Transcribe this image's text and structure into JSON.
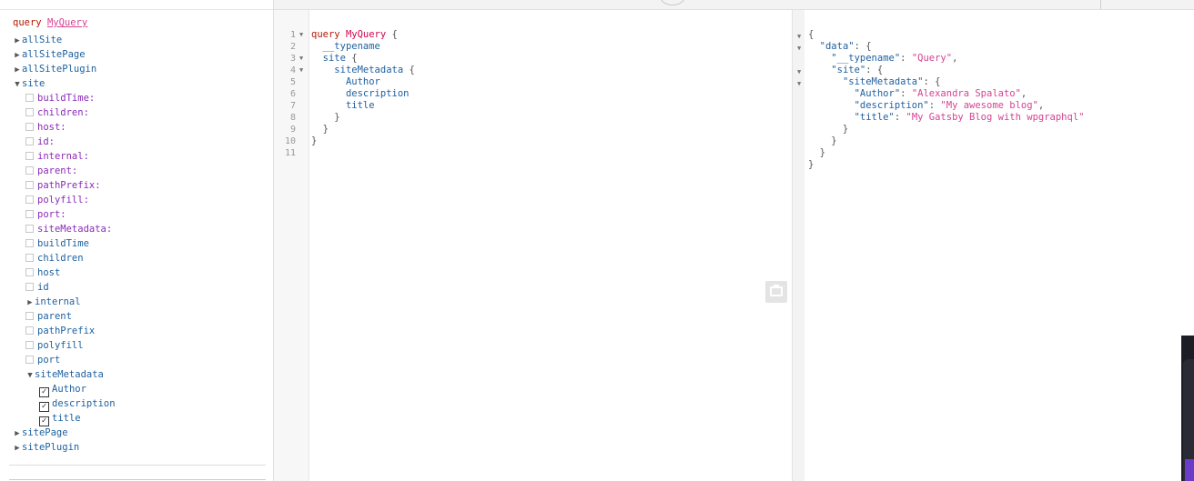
{
  "explorer": {
    "operation_keyword": "query",
    "operation_name": "MyQuery",
    "root_fields": [
      {
        "label": "allSite",
        "expanded": false
      },
      {
        "label": "allSitePage",
        "expanded": false
      },
      {
        "label": "allSitePlugin",
        "expanded": false
      },
      {
        "label": "site",
        "expanded": true
      },
      {
        "label": "sitePage",
        "expanded": false
      },
      {
        "label": "sitePlugin",
        "expanded": false
      }
    ],
    "site_arguments": [
      "buildTime:",
      "children:",
      "host:",
      "id:",
      "internal:",
      "parent:",
      "pathPrefix:",
      "polyfill:",
      "port:",
      "siteMetadata:"
    ],
    "site_fields": [
      {
        "label": "buildTime",
        "kind": "checkbox"
      },
      {
        "label": "children",
        "kind": "checkbox"
      },
      {
        "label": "host",
        "kind": "checkbox"
      },
      {
        "label": "id",
        "kind": "checkbox"
      },
      {
        "label": "internal",
        "kind": "expandable"
      },
      {
        "label": "parent",
        "kind": "checkbox"
      },
      {
        "label": "pathPrefix",
        "kind": "checkbox"
      },
      {
        "label": "polyfill",
        "kind": "checkbox"
      },
      {
        "label": "port",
        "kind": "checkbox"
      },
      {
        "label": "siteMetadata",
        "kind": "expanded"
      }
    ],
    "site_metadata_fields": [
      {
        "label": "Author",
        "checked": true
      },
      {
        "label": "description",
        "checked": true
      },
      {
        "label": "title",
        "checked": true
      }
    ]
  },
  "editor": {
    "line_numbers": [
      "1",
      "2",
      "3",
      "4",
      "5",
      "6",
      "7",
      "8",
      "9",
      "10",
      "11"
    ],
    "tokens": {
      "query": "query",
      "my_query": "MyQuery",
      "open_brace": "{",
      "close_brace": "}",
      "typename": "__typename",
      "site": "site",
      "site_metadata": "siteMetadata",
      "author": "Author",
      "description": "description",
      "title": "title"
    }
  },
  "result": {
    "open": "{",
    "close": "}",
    "data_key": "\"data\"",
    "typename_key": "\"__typename\"",
    "typename_value": "\"Query\"",
    "site_key": "\"site\"",
    "site_metadata_key": "\"siteMetadata\"",
    "author_key": "\"Author\"",
    "author_value": "\"Alexandra Spalato\"",
    "description_key": "\"description\"",
    "description_value": "\"My awesome blog\"",
    "title_key": "\"title\"",
    "title_value": "\"My Gatsby Blog with wpgraphql\""
  },
  "icons": {
    "collapsed_arrow": "▶",
    "expanded_arrow": "▼",
    "fold_arrow": "▼",
    "check_mark": "✓",
    "prettify": "prettify-icon"
  }
}
